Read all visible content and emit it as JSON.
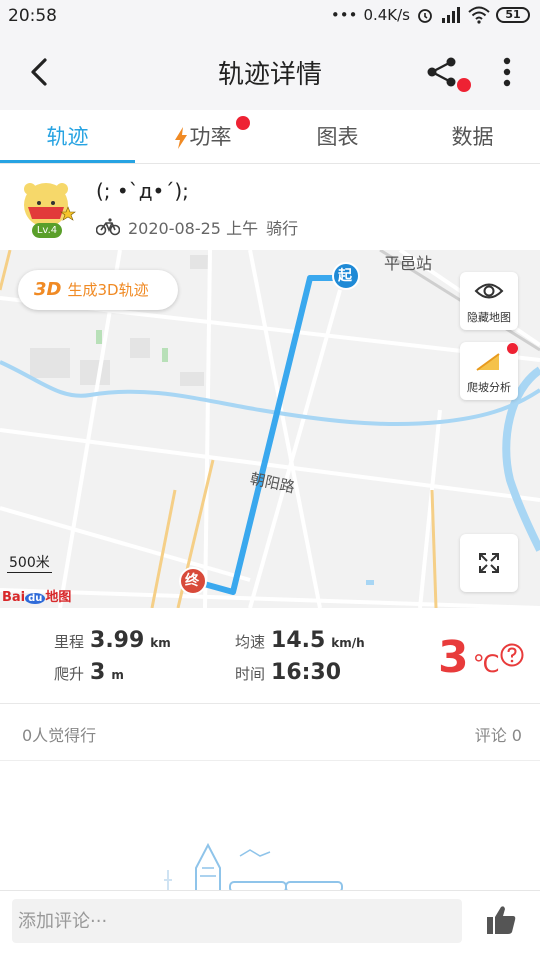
{
  "status_bar": {
    "time": "20:58",
    "speed": "0.4K/s",
    "battery": "51"
  },
  "header": {
    "title": "轨迹详情"
  },
  "tabs": [
    {
      "label": "轨迹",
      "active": true
    },
    {
      "label": "功率",
      "active": false,
      "has_badge": true
    },
    {
      "label": "图表",
      "active": false
    },
    {
      "label": "数据",
      "active": false
    }
  ],
  "user": {
    "name": "(; •`д•´);",
    "level": "Lv.4",
    "date": "2020-08-25 上午",
    "activity": "骑行"
  },
  "map": {
    "btn_3d_tag": "3D",
    "btn_3d_label": "生成3D轨迹",
    "hide_map_label": "隐藏地图",
    "climb_analysis_label": "爬坡分析",
    "start_marker": "起",
    "end_marker": "终",
    "station_label": "平邑站",
    "road_label": "朝阳路",
    "scale": "500米",
    "logo_text_1": "Bai",
    "logo_text_2": "du",
    "logo_text_3": "地图"
  },
  "stats": {
    "distance_label": "里程",
    "distance_value": "3.99",
    "distance_unit": "km",
    "avg_speed_label": "均速",
    "avg_speed_value": "14.5",
    "avg_speed_unit": "km/h",
    "climb_label": "爬升",
    "climb_value": "3",
    "climb_unit": "m",
    "time_label": "时间",
    "time_value": "16:30",
    "temperature_value": "3",
    "temperature_unit": "℃"
  },
  "social": {
    "likes_text": "0人觉得行",
    "comments_text": "评论 0"
  },
  "comment_box": {
    "placeholder": "添加评论···"
  },
  "colors": {
    "accent": "#27a3e2",
    "route": "#3aa8ee",
    "temperature": "#e83b3b",
    "badge": "#ee2233",
    "climb_orange": "#f08a24"
  }
}
